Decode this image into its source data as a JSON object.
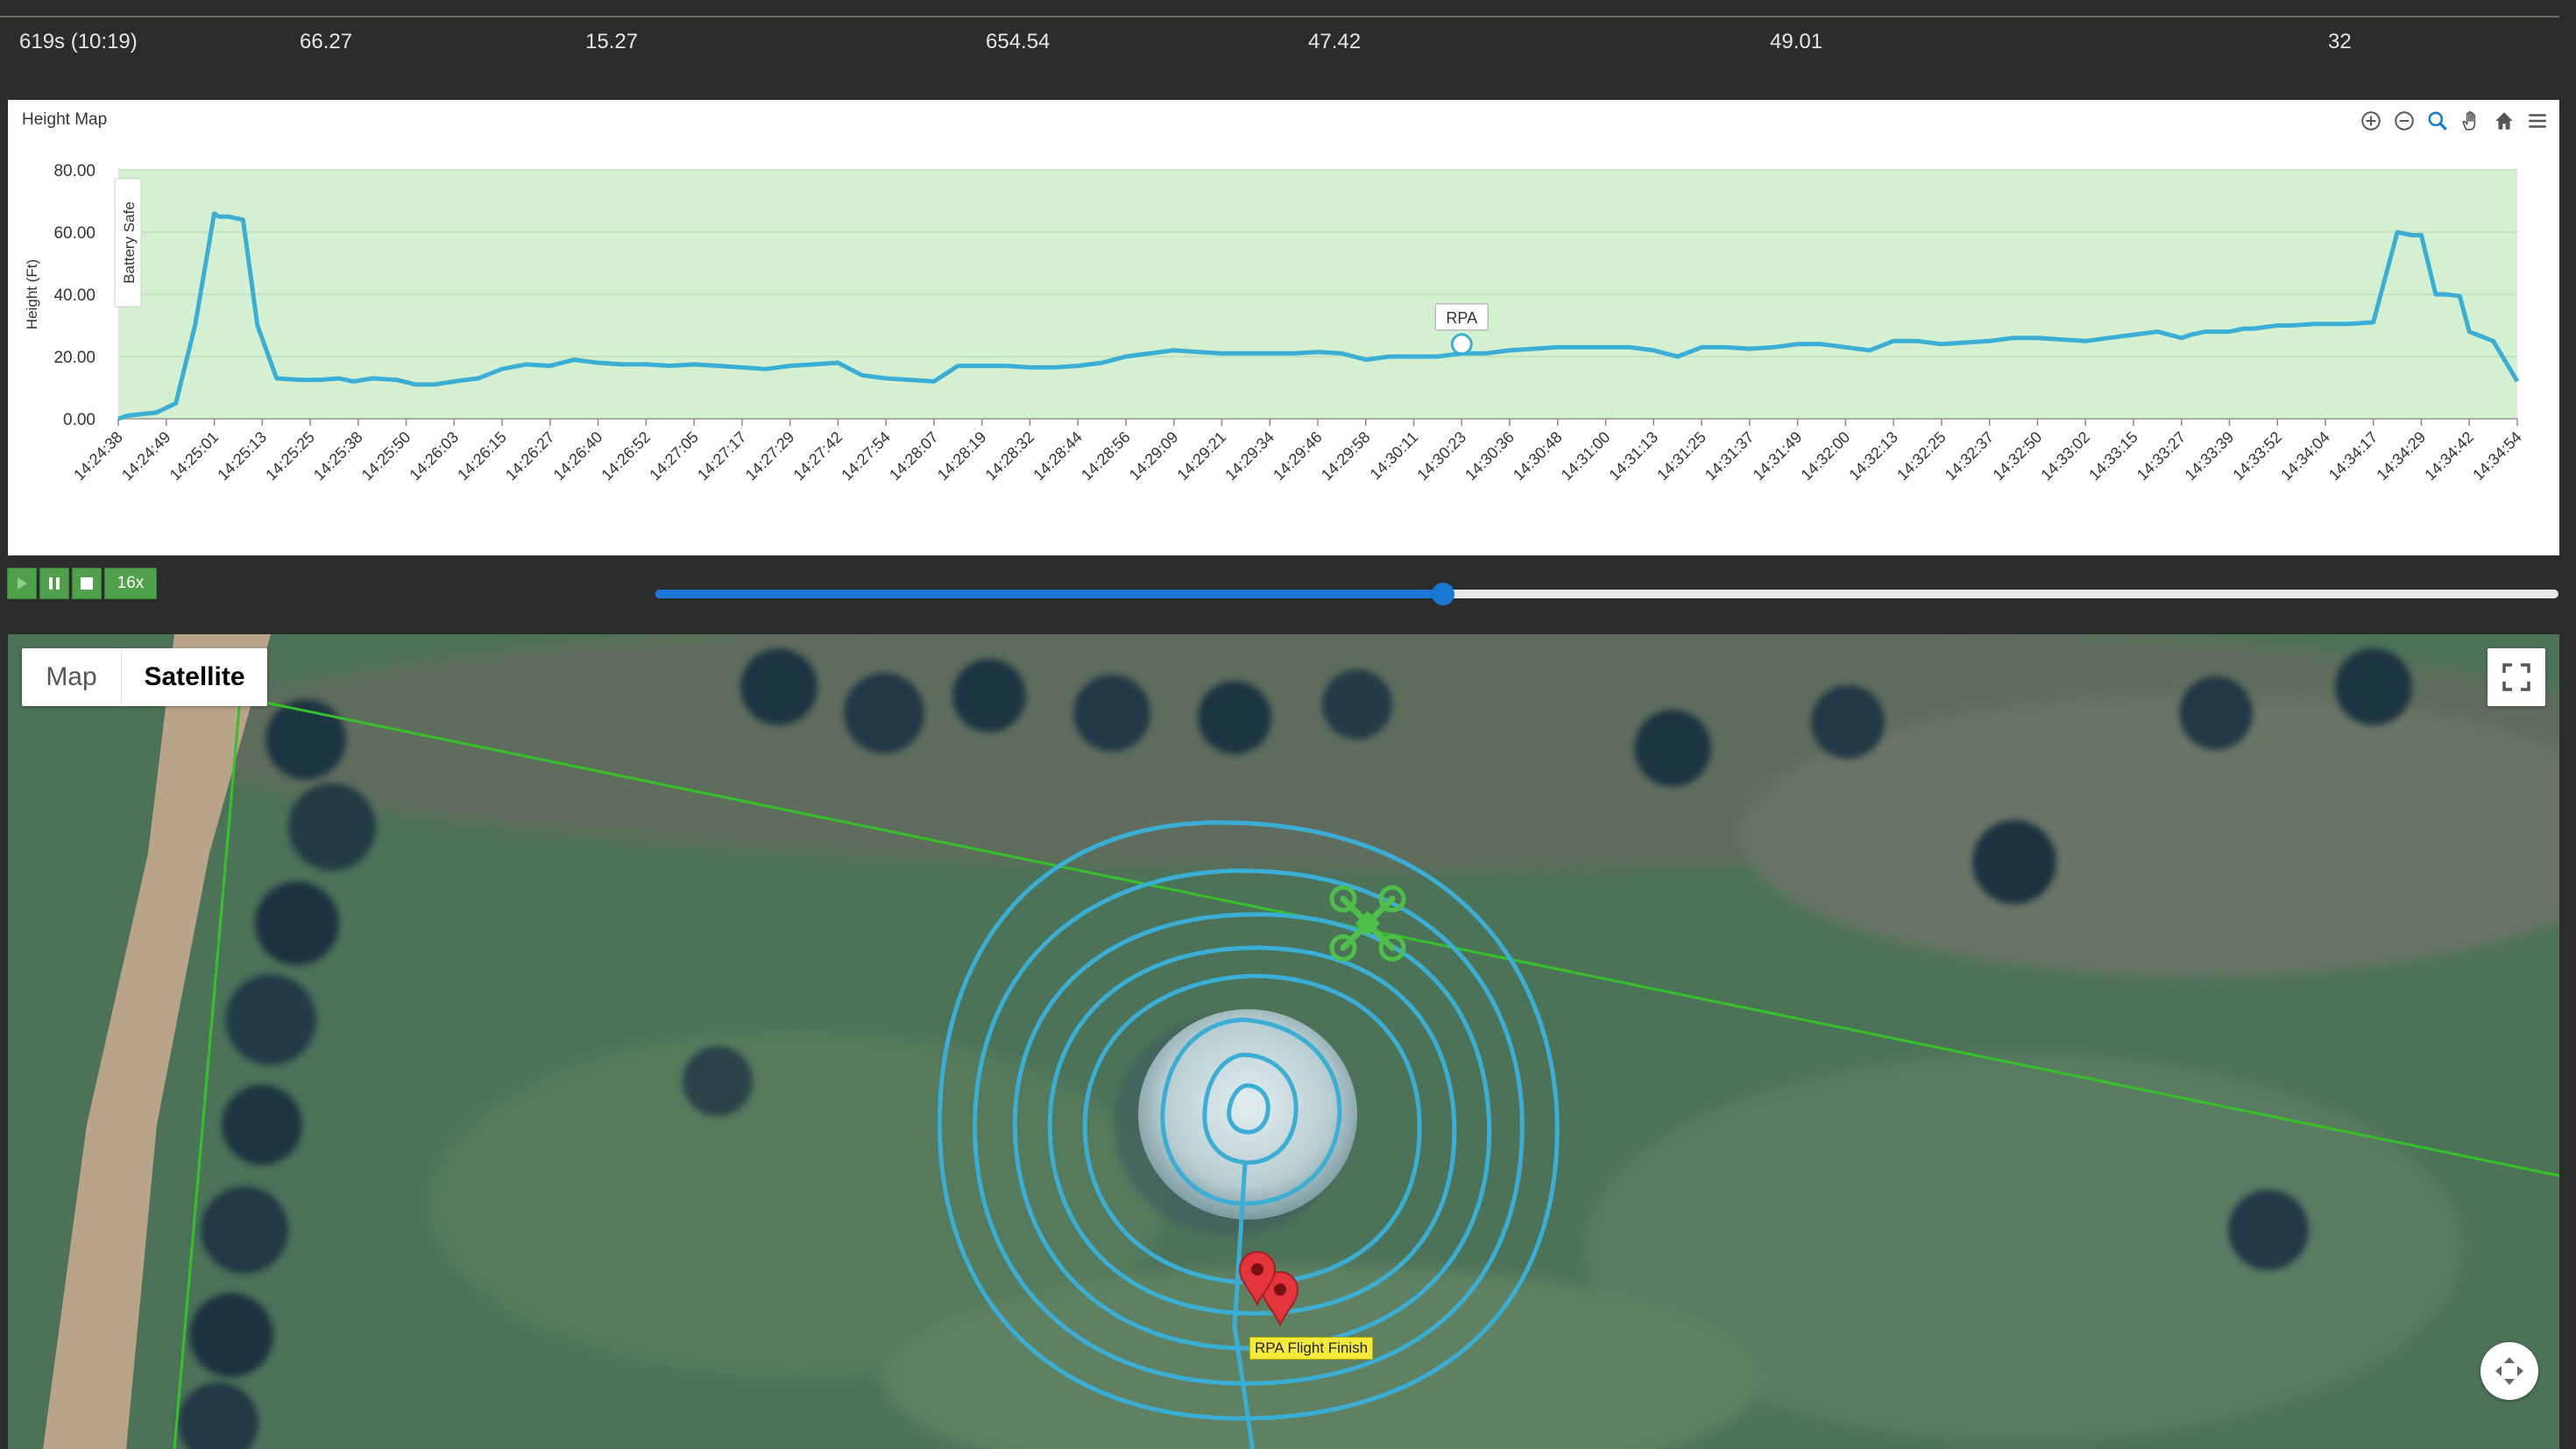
{
  "stats": {
    "values": [
      "619s (10:19)",
      "66.27",
      "15.27",
      "654.54",
      "47.42",
      "49.01",
      "32"
    ]
  },
  "chart": {
    "title": "Height Map",
    "toolbar_icons": [
      "zoom-in-icon",
      "zoom-out-icon",
      "zoom-select-icon",
      "pan-hand-icon",
      "home-reset-icon",
      "menu-icon"
    ],
    "chart_data": {
      "type": "line",
      "title": "Height Map",
      "ylabel": "Height (Ft)",
      "xlabel": "",
      "ylim": [
        0,
        80
      ],
      "yticks": [
        "80.00",
        "60.00",
        "40.00",
        "20.00",
        "0.00"
      ],
      "ytick_values": [
        80,
        60,
        40,
        20,
        0
      ],
      "band": {
        "label": "Battery Safe",
        "color": "#d4f0d0"
      },
      "series_color": "#3aaed4",
      "marker": {
        "label": "RPA",
        "time": "14:30:23",
        "value": 24
      },
      "categories": [
        "14:24:38",
        "14:24:49",
        "14:25:01",
        "14:25:13",
        "14:25:25",
        "14:25:38",
        "14:25:50",
        "14:26:03",
        "14:26:15",
        "14:26:27",
        "14:26:40",
        "14:26:52",
        "14:27:05",
        "14:27:17",
        "14:27:29",
        "14:27:42",
        "14:27:54",
        "14:28:07",
        "14:28:19",
        "14:28:32",
        "14:28:44",
        "14:28:56",
        "14:29:09",
        "14:29:21",
        "14:29:34",
        "14:29:46",
        "14:29:58",
        "14:30:11",
        "14:30:23",
        "14:30:36",
        "14:30:48",
        "14:31:00",
        "14:31:13",
        "14:31:25",
        "14:31:37",
        "14:31:49",
        "14:32:00",
        "14:32:13",
        "14:32:25",
        "14:32:37",
        "14:32:50",
        "14:33:02",
        "14:33:15",
        "14:33:27",
        "14:33:39",
        "14:33:52",
        "14:34:04",
        "14:34:17",
        "14:34:29",
        "14:34:42",
        "14:34:54"
      ],
      "x": [
        0,
        0.2,
        0.8,
        1.2,
        1.6,
        2.0,
        2.1,
        2.3,
        2.6,
        2.9,
        3.3,
        3.8,
        4.2,
        4.6,
        4.9,
        5.3,
        5.8,
        6.2,
        6.6,
        7.0,
        7.5,
        8.0,
        8.5,
        9.0,
        9.5,
        10.0,
        10.5,
        11.0,
        11.5,
        12.0,
        12.5,
        13.0,
        13.5,
        14.0,
        14.5,
        15.0,
        15.5,
        16.0,
        16.5,
        17.0,
        17.5,
        18.0,
        18.5,
        19.0,
        19.5,
        20.0,
        20.5,
        21.0,
        21.5,
        22.0,
        22.5,
        23.0,
        23.5,
        24.0,
        24.5,
        25.0,
        25.5,
        26.0,
        26.5,
        27.0,
        27.5,
        28.0,
        28.5,
        29.0,
        29.5,
        30.0,
        30.5,
        31.0,
        31.5,
        32.0,
        32.5,
        33.0,
        33.5,
        34.0,
        34.5,
        35.0,
        35.5,
        36.0,
        36.5,
        37.0,
        37.5,
        38.0,
        38.5,
        39.0,
        39.5,
        40.0,
        40.5,
        41.0,
        41.5,
        42.0,
        42.5,
        43.0,
        43.2,
        43.5,
        44.0,
        44.3,
        44.5,
        45.0,
        45.3,
        45.8,
        46.0,
        46.5,
        47.0,
        47.5,
        47.8,
        48.0,
        48.3,
        48.5,
        48.8,
        49.0,
        49.5,
        50.0
      ],
      "values": [
        0,
        1,
        2,
        5,
        30,
        66,
        65,
        65,
        64,
        30,
        13,
        12.5,
        12.5,
        13,
        12,
        13,
        12.5,
        11,
        11,
        12,
        13,
        16,
        17.5,
        17,
        19,
        18,
        17.5,
        17.5,
        17,
        17.5,
        17,
        16.5,
        16,
        17,
        17.5,
        18,
        14,
        13,
        12.5,
        12,
        17,
        17,
        17,
        16.5,
        16.5,
        17,
        18,
        20,
        21,
        22,
        21.5,
        21,
        21,
        21,
        21,
        21.5,
        21,
        19,
        20,
        20,
        20,
        21,
        21,
        22,
        22.5,
        23,
        23,
        23,
        23,
        22,
        20,
        23,
        23,
        22.5,
        23,
        24,
        24,
        23,
        22,
        25,
        25,
        24,
        24.5,
        25,
        26,
        26,
        25.5,
        25,
        26,
        27,
        28,
        26,
        27,
        28,
        28,
        29,
        29,
        30,
        30,
        30.5,
        30.5,
        30.5,
        31,
        60,
        59,
        59,
        40,
        40,
        39.5,
        28,
        25,
        12,
        5,
        3,
        2,
        0
      ]
    }
  },
  "playback": {
    "speed_label": "16x",
    "progress": 0.414
  },
  "map": {
    "type_map_label": "Map",
    "type_satellite_label": "Satellite",
    "finish_label": "RPA Flight Finish",
    "boundary_color": "#36c02a",
    "path_color": "#3aaed4",
    "drone_color": "#4ec04a",
    "marker_color": "#e5353c"
  }
}
